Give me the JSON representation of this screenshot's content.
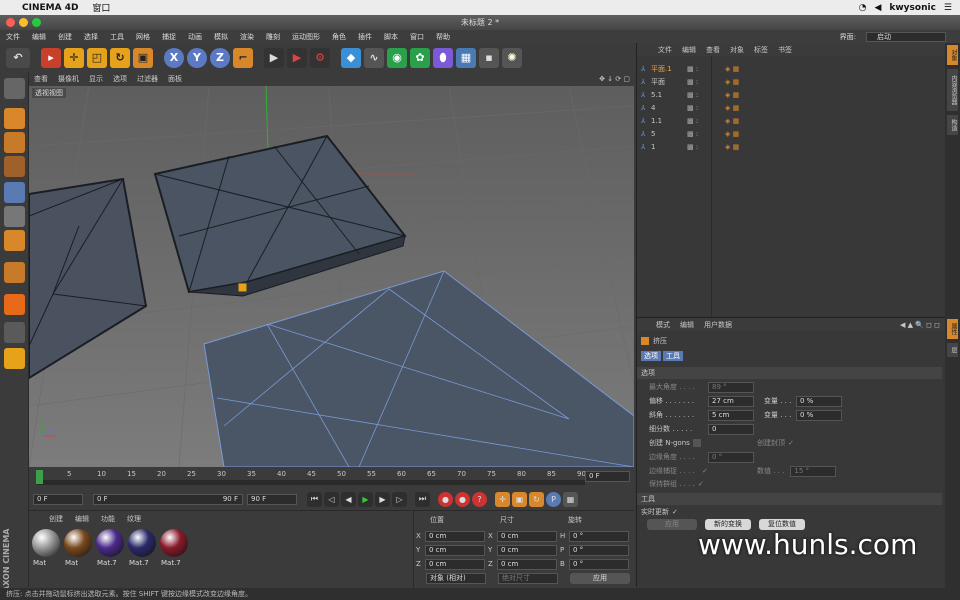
{
  "mac_menubar": {
    "app": "CINEMA 4D",
    "window_menu": "窗口",
    "user": "kwysonic"
  },
  "window": {
    "title": "未标题 2 *"
  },
  "main_menu": [
    "文件",
    "编辑",
    "创建",
    "选择",
    "工具",
    "网格",
    "捕捉",
    "动画",
    "模拟",
    "渲染",
    "雕刻",
    "运动图形",
    "角色",
    "插件",
    "脚本",
    "窗口",
    "帮助"
  ],
  "interface": {
    "label": "界面:",
    "value": "启动"
  },
  "viewport": {
    "menu": [
      "查看",
      "摄像机",
      "显示",
      "选项",
      "过滤器",
      "面板"
    ],
    "label": "透视视图"
  },
  "timeline": {
    "ticks": [
      "0",
      "5",
      "10",
      "15",
      "20",
      "25",
      "30",
      "35",
      "40",
      "45",
      "50",
      "55",
      "60",
      "65",
      "70",
      "75",
      "80",
      "85",
      "90"
    ],
    "end_field": "0 F"
  },
  "transport": {
    "current": "0 F",
    "range_start": "0 F",
    "range_end": "90 F",
    "max": "90 F"
  },
  "material_manager": {
    "menu": [
      "创建",
      "编辑",
      "功能",
      "纹理"
    ],
    "materials": [
      {
        "name": "Mat",
        "color": "#9a9a9a"
      },
      {
        "name": "Mat",
        "color": "#7a4a1e"
      },
      {
        "name": "Mat.7",
        "color": "#4a2a8a"
      },
      {
        "name": "Mat.7",
        "color": "#2a2a6a"
      },
      {
        "name": "Mat.7",
        "color": "#8a1a2a"
      }
    ]
  },
  "coordinates": {
    "headers": [
      "位置",
      "尺寸",
      "旋转"
    ],
    "rows": [
      {
        "pos_axis": "X",
        "pos": "0 cm",
        "size_axis": "X",
        "size": "0 cm",
        "rot_axis": "H",
        "rot": "0 °"
      },
      {
        "pos_axis": "Y",
        "pos": "0 cm",
        "size_axis": "Y",
        "size": "0 cm",
        "rot_axis": "P",
        "rot": "0 °"
      },
      {
        "pos_axis": "Z",
        "pos": "0 cm",
        "size_axis": "Z",
        "size": "0 cm",
        "rot_axis": "B",
        "rot": "0 °"
      }
    ],
    "mode": "对象 (相对)",
    "size_mode": "绝对尺寸",
    "apply": "应用"
  },
  "object_manager": {
    "menu": [
      "文件",
      "编辑",
      "查看",
      "对象",
      "标签",
      "书签"
    ],
    "objects": [
      "平面.1",
      "平面",
      "5.1",
      "4",
      "1.1",
      "5",
      "1"
    ]
  },
  "attribute_manager": {
    "menu": [
      "模式",
      "编辑",
      "用户数据"
    ],
    "tool_name": "挤压",
    "tabs": [
      "选项",
      "工具"
    ],
    "section": "选项",
    "params": [
      {
        "label": "最大角度 . . . .",
        "value": "89 °",
        "disabled": true
      },
      {
        "label": "偏移 . . . . . . .",
        "value": "27 cm",
        "var_label": "变量 . . .",
        "var_value": "0 %"
      },
      {
        "label": "斜角 . . . . . . .",
        "value": "5 cm",
        "var_label": "变量 . . .",
        "var_value": "0 %"
      },
      {
        "label": "细分数 . . . . .",
        "value": "0"
      }
    ],
    "ngons_label": "创建 N-gons",
    "cap_label": "创建封顶",
    "edge_angle_label": "边缘角度 . . . .",
    "edge_angle_value": "0 °",
    "edge_snap_label": "边缘捕捉 . . . .",
    "value_label": "数值 . . .",
    "value_value": "15 °",
    "keep_groups_label": "保持群组 . . . .",
    "tool_section": "工具",
    "realtime_label": "实时更新",
    "buttons": [
      "应用",
      "新的变换",
      "复位数值"
    ]
  },
  "right_tabs": [
    "对象",
    "内容浏览器",
    "构造",
    "属性",
    "层"
  ],
  "status": "挤压: 点击并拖动鼠标挤出选取元素。按住 SHIFT 键按边缘模式改变边缘角度。",
  "watermark": "www.hunls.com",
  "logo": "MAXON CINEMA 4D"
}
